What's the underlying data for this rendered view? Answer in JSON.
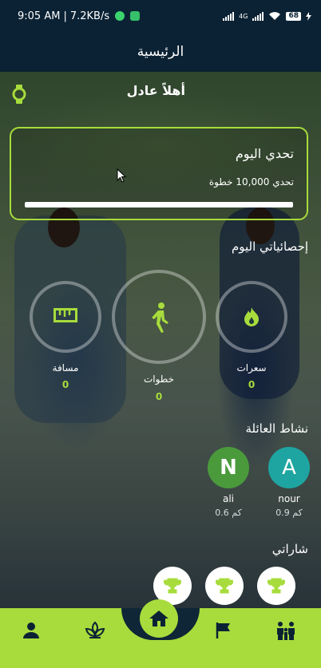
{
  "status": {
    "time": "9:05 AM",
    "speed": "7.2KB/s",
    "network": "4G",
    "battery": "68"
  },
  "appbar": {
    "title": "الرئيسية"
  },
  "greeting": "أهلاً عادل",
  "challenge": {
    "title": "تحدي اليوم",
    "subtitle": "تحدي 10,000 خطوة",
    "progress_fraction": 0.0
  },
  "stats": {
    "section_title": "إحصائياتي اليوم",
    "items": [
      {
        "label": "سعرات",
        "value": "0",
        "icon": "fire-icon"
      },
      {
        "label": "خطوات",
        "value": "0",
        "icon": "walking-icon"
      },
      {
        "label": "مسافة",
        "value": "0",
        "icon": "ruler-icon"
      }
    ]
  },
  "family": {
    "section_title": "نشاط العائلة",
    "members": [
      {
        "initial": "A",
        "name": "nour",
        "distance": "0.9 كم",
        "color": "#1ea5a1"
      },
      {
        "initial": "N",
        "name": "ali",
        "distance": "0.6 كم",
        "color": "#4a9a3c"
      }
    ]
  },
  "badges": {
    "section_title": "شاراتي",
    "icon": "trophy-icon",
    "count": 3
  },
  "nav": {
    "items": [
      "person-icon",
      "plant-icon",
      "home-icon",
      "flag-icon",
      "family-icon"
    ],
    "active": "home-icon"
  },
  "colors": {
    "accent": "#a7dc3c",
    "bar": "#0b2234"
  }
}
